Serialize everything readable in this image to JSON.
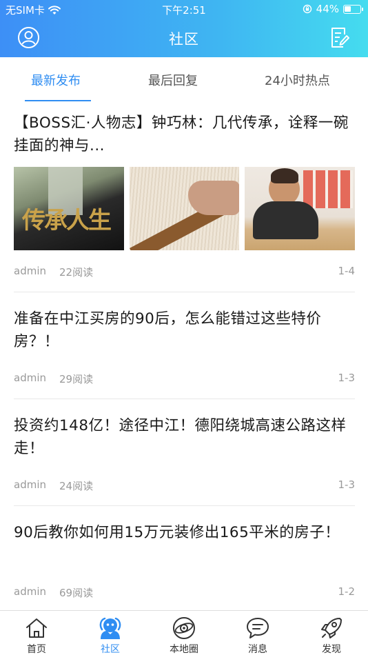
{
  "status_bar": {
    "carrier": "无SIM卡",
    "time": "下午2:51",
    "battery_percent": "44%",
    "battery_level": 0.44
  },
  "navbar": {
    "title": "社区",
    "left_icon": "avatar-icon",
    "right_icon": "edit-document-icon"
  },
  "tabs": [
    {
      "label": "最新发布",
      "active": true
    },
    {
      "label": "最后回复",
      "active": false
    },
    {
      "label": "24小时热点",
      "active": false
    }
  ],
  "posts": [
    {
      "title": "【BOSS汇·人物志】钟巧林：几代传承，诠释一碗挂面的神与...",
      "thumbnail_caption": "传承人生",
      "author": "admin",
      "reads": "22阅读",
      "date": "1-4"
    },
    {
      "title": "准备在中江买房的90后，怎么能错过这些特价房？！",
      "author": "admin",
      "reads": "29阅读",
      "date": "1-3"
    },
    {
      "title": "投资约148亿！途径中江！德阳绕城高速公路这样走！",
      "author": "admin",
      "reads": "24阅读",
      "date": "1-3"
    },
    {
      "title": "90后教你如何用15万元装修出165平米的房子！",
      "author": "admin",
      "reads": "69阅读",
      "date": "1-2"
    }
  ],
  "bottom_nav": [
    {
      "label": "首页",
      "icon": "home-icon",
      "active": false
    },
    {
      "label": "社区",
      "icon": "community-icon",
      "active": true
    },
    {
      "label": "本地圈",
      "icon": "local-circle-icon",
      "active": false
    },
    {
      "label": "消息",
      "icon": "message-icon",
      "active": false
    },
    {
      "label": "发现",
      "icon": "rocket-icon",
      "active": false
    }
  ],
  "colors": {
    "accent": "#2f8df2",
    "header_start": "#3d8ff6",
    "header_end": "#45dcef",
    "meta_text": "#999999"
  }
}
